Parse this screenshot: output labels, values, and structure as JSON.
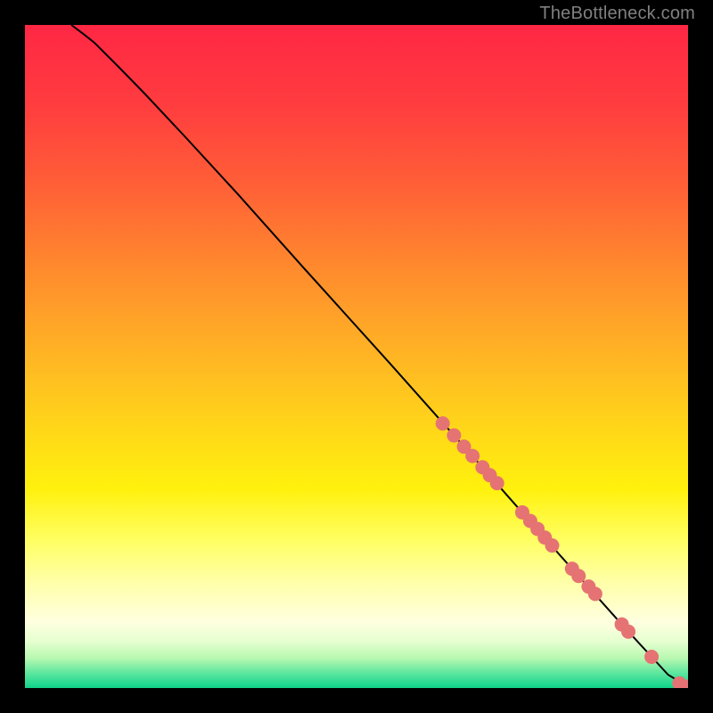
{
  "attribution": "TheBottleneck.com",
  "chart_data": {
    "type": "line",
    "title": "",
    "xlabel": "",
    "ylabel": "",
    "xlim": [
      0,
      100
    ],
    "ylim": [
      0,
      100
    ],
    "background_gradient_stops": [
      {
        "offset": 0.0,
        "color": "#ff2744"
      },
      {
        "offset": 0.12,
        "color": "#ff3c3f"
      },
      {
        "offset": 0.25,
        "color": "#ff6236"
      },
      {
        "offset": 0.37,
        "color": "#ff8b2d"
      },
      {
        "offset": 0.5,
        "color": "#ffb524"
      },
      {
        "offset": 0.6,
        "color": "#ffd41a"
      },
      {
        "offset": 0.7,
        "color": "#fff10d"
      },
      {
        "offset": 0.78,
        "color": "#ffff66"
      },
      {
        "offset": 0.84,
        "color": "#ffffa8"
      },
      {
        "offset": 0.9,
        "color": "#ffffe0"
      },
      {
        "offset": 0.93,
        "color": "#e5ffd0"
      },
      {
        "offset": 0.955,
        "color": "#b8f8b0"
      },
      {
        "offset": 0.975,
        "color": "#66e8a0"
      },
      {
        "offset": 0.995,
        "color": "#1fd890"
      },
      {
        "offset": 1.0,
        "color": "#12cf87"
      }
    ],
    "series": [
      {
        "name": "curve",
        "type": "line",
        "x": [
          7,
          9,
          10.5,
          12,
          14,
          18,
          24,
          32,
          42,
          55,
          68,
          80,
          90,
          97,
          100
        ],
        "y": [
          100,
          98.5,
          97.3,
          95.8,
          93.8,
          89.7,
          83.3,
          74.6,
          63.4,
          49.0,
          34.4,
          20.8,
          9.6,
          2.0,
          0.2
        ]
      },
      {
        "name": "markers",
        "type": "scatter",
        "x": [
          63,
          64.7,
          66.2,
          67.5,
          69,
          70.1,
          71.2,
          75,
          76.2,
          77.3,
          78.4,
          79.5,
          82.5,
          83.5,
          85,
          86,
          90,
          91,
          94.5,
          98.7,
          100
        ],
        "y": [
          39.9,
          38.1,
          36.4,
          35.0,
          33.3,
          32.1,
          30.9,
          26.5,
          25.2,
          24.0,
          22.7,
          21.5,
          18.0,
          16.9,
          15.3,
          14.2,
          9.6,
          8.5,
          4.7,
          0.7,
          0.2
        ]
      }
    ],
    "marker_color": "#e57373",
    "line_color": "#000000"
  }
}
